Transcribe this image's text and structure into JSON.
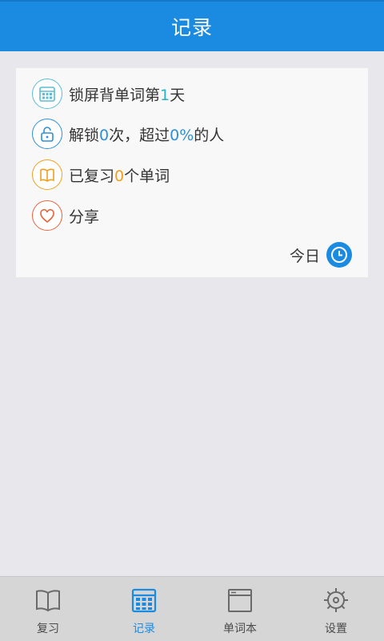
{
  "header": {
    "title": "记录"
  },
  "stats": {
    "days": {
      "prefix": "锁屏背单词第",
      "value": "1",
      "suffix": "天",
      "icon": "calendar-icon",
      "color": "#5bbcd6"
    },
    "unlock": {
      "prefix": "解锁",
      "count": "0",
      "middle": "次，超过",
      "percent": "0%",
      "suffix": "的人",
      "icon": "lock-icon",
      "color": "#2e8fd6"
    },
    "review": {
      "prefix": "已复习",
      "value": "0",
      "suffix": "个单词",
      "icon": "book-icon",
      "color": "#f0a020"
    },
    "share": {
      "label": "分享",
      "icon": "heart-icon",
      "color": "#e8623a"
    }
  },
  "today": {
    "label": "今日",
    "icon": "clock-icon"
  },
  "tabs": [
    {
      "label": "复习",
      "icon": "book-icon",
      "active": false
    },
    {
      "label": "记录",
      "icon": "calendar-icon",
      "active": true
    },
    {
      "label": "单词本",
      "icon": "window-icon",
      "active": false
    },
    {
      "label": "设置",
      "icon": "gear-icon",
      "active": false
    }
  ],
  "colors": {
    "accent": "#1a8be0",
    "days_number": "#2bb0c8",
    "unlock_number": "#2e8fd6",
    "review_number": "#f0a020"
  }
}
